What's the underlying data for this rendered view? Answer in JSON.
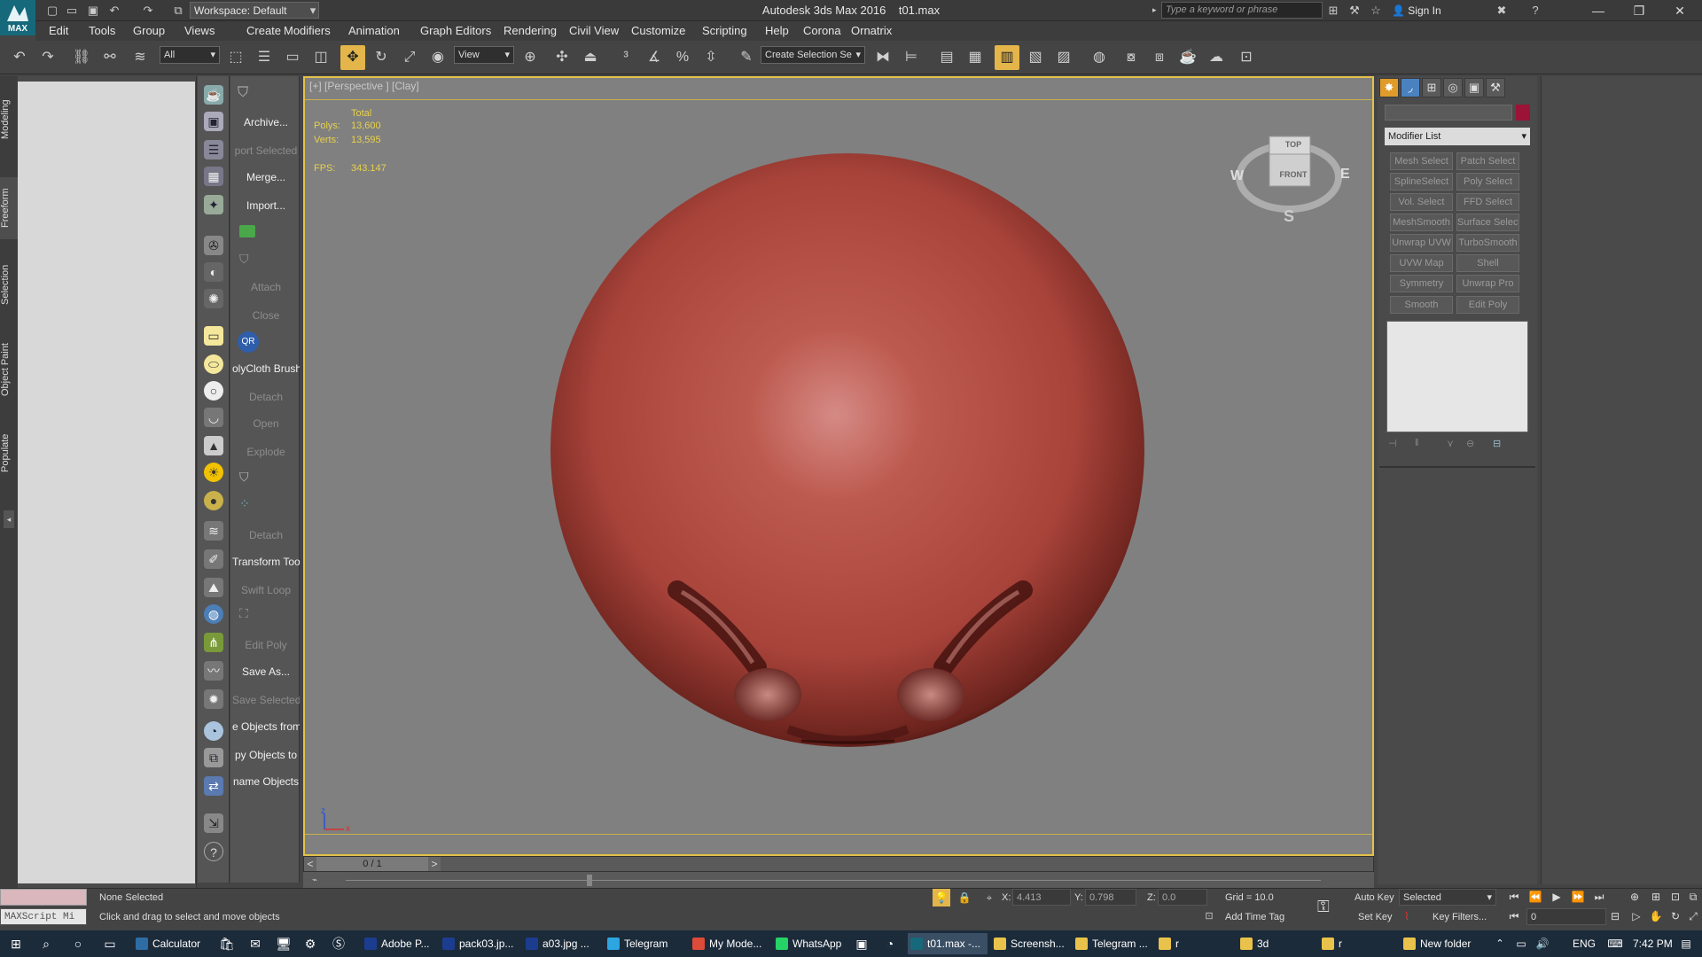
{
  "app": {
    "title": "Autodesk 3ds Max 2016",
    "file": "t01.max",
    "logo": "MAX",
    "workspace": "Workspace: Default",
    "search_placeholder": "Type a keyword or phrase",
    "signin": "Sign In"
  },
  "menu": [
    "Edit",
    "Tools",
    "Group",
    "Views",
    "Create",
    "Modifiers",
    "Animation",
    "Graph Editors",
    "Rendering",
    "Civil View",
    "Customize",
    "Scripting",
    "Help",
    "Corona",
    "Ornatrix"
  ],
  "toolbar": {
    "filter": "All",
    "refcoord": "View",
    "selection_set": "Create Selection Se"
  },
  "ribbon_tabs": [
    "Modeling",
    "Freeform",
    "Selection",
    "Object Paint",
    "Populate"
  ],
  "cmd_items": [
    {
      "label": "Archive...",
      "enabled": true
    },
    {
      "label": "port Selected",
      "enabled": false
    },
    {
      "label": "Merge...",
      "enabled": true
    },
    {
      "label": "Import...",
      "enabled": true
    },
    {
      "label": "Attach",
      "enabled": false
    },
    {
      "label": "Close",
      "enabled": false
    },
    {
      "label": "olyCloth Brush",
      "enabled": true
    },
    {
      "label": "Detach",
      "enabled": false
    },
    {
      "label": "Open",
      "enabled": false
    },
    {
      "label": "Explode",
      "enabled": false
    },
    {
      "label": "Detach",
      "enabled": false
    },
    {
      "label": "Transform Tool",
      "enabled": true
    },
    {
      "label": "Swift Loop",
      "enabled": false
    },
    {
      "label": "Edit Poly",
      "enabled": false
    },
    {
      "label": "Save As...",
      "enabled": true
    },
    {
      "label": "Save Selected",
      "enabled": false
    },
    {
      "label": "e Objects from",
      "enabled": true
    },
    {
      "label": "py Objects to",
      "enabled": true
    },
    {
      "label": "name Objects",
      "enabled": true
    }
  ],
  "viewport": {
    "label": "[+] [Perspective ] [Clay]",
    "stats": {
      "total_label": "Total",
      "polys_label": "Polys:",
      "polys": "13,600",
      "verts_label": "Verts:",
      "verts": "13,595",
      "fps_label": "FPS:",
      "fps": "343.147"
    },
    "viewcube": {
      "top": "TOP",
      "front": "FRONT",
      "w": "W",
      "e": "E",
      "s": "S"
    },
    "axis_z": "z",
    "axis_x": "x",
    "colors": {
      "object": "#b34a3e",
      "background": "#808080",
      "frame": "#e3c24a"
    }
  },
  "timeline": {
    "frame": "0 / 1",
    "prev": "<",
    "next": ">"
  },
  "command_panel": {
    "modifier_list": "Modifier List",
    "color_swatch": "#9b1337",
    "modifiers": [
      "Mesh Select",
      "Patch Select",
      "SplineSelect",
      "Poly Select",
      "Vol. Select",
      "FFD Select",
      "MeshSmooth",
      "Surface Select",
      "Unwrap UVW",
      "TurboSmooth",
      "UVW Map",
      "Shell",
      "Symmetry",
      "Unwrap Pro",
      "Smooth",
      "Edit Poly"
    ]
  },
  "status": {
    "maxscript": "MAXScript Mi",
    "selection": "None Selected",
    "prompt": "Click and drag to select and move objects",
    "x_label": "X:",
    "x": "4.413",
    "y_label": "Y:",
    "y": "0.798",
    "z_label": "Z:",
    "z": "0.0",
    "grid": "Grid = 10.0",
    "add_time_tag": "Add Time Tag",
    "auto_key": "Auto Key",
    "set_key": "Set Key",
    "selected": "Selected",
    "key_filters": "Key Filters...",
    "frame_field": "0"
  },
  "taskbar": {
    "items": [
      {
        "label": "Calculator",
        "color": "#2d6da3"
      },
      {
        "label": "Adobe P...",
        "color": "#1c3d8f"
      },
      {
        "label": "pack03.jp...",
        "color": "#1c3d8f"
      },
      {
        "label": "a03.jpg ...",
        "color": "#1c3d8f"
      },
      {
        "label": "Telegram",
        "color": "#2ca5e0"
      },
      {
        "label": "My Mode...",
        "color": "#dd4b39"
      },
      {
        "label": "WhatsApp",
        "color": "#25d366"
      },
      {
        "label": "t01.max -...",
        "color": "#16697a"
      },
      {
        "label": "Screensh...",
        "color": "#e8c24a"
      },
      {
        "label": "Telegram ...",
        "color": "#e8c24a"
      },
      {
        "label": "r",
        "color": "#e8c24a"
      },
      {
        "label": "3d",
        "color": "#e8c24a"
      },
      {
        "label": "r",
        "color": "#e8c24a"
      },
      {
        "label": "New folder",
        "color": "#e8c24a"
      }
    ],
    "lang": "ENG",
    "time": "7:42 PM"
  }
}
